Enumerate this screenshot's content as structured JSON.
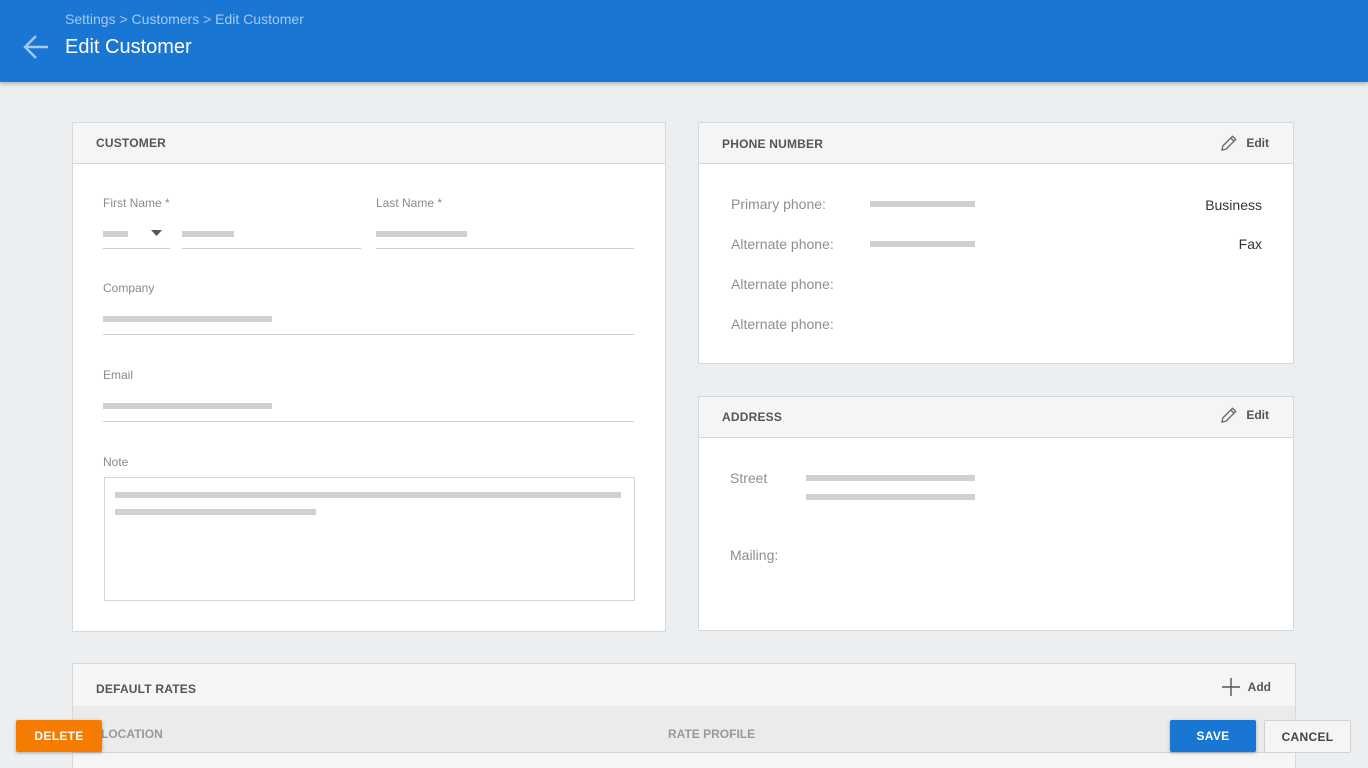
{
  "header": {
    "breadcrumb": "Settings > Customers > Edit Customer",
    "title": "Edit Customer",
    "back_icon": "arrow-left-icon",
    "color": "#1976d2"
  },
  "customer_card": {
    "title": "CUSTOMER",
    "first_name_label": "First Name *",
    "last_name_label": "Last Name *",
    "company_label": "Company",
    "email_label": "Email",
    "note_label": "Note"
  },
  "phone_card": {
    "title": "PHONE NUMBER",
    "edit_label": "Edit",
    "edit_icon": "pencil-icon",
    "rows": [
      {
        "label": "Primary phone:",
        "type": "Business"
      },
      {
        "label": "Alternate phone:",
        "type": "Fax"
      },
      {
        "label": "Alternate phone:",
        "type": ""
      },
      {
        "label": "Alternate phone:",
        "type": ""
      }
    ]
  },
  "address_card": {
    "title": "ADDRESS",
    "edit_label": "Edit",
    "edit_icon": "pencil-icon",
    "street_label": "Street",
    "mailing_label": "Mailing:"
  },
  "rates_card": {
    "title": "DEFAULT RATES",
    "add_label": "Add",
    "add_icon": "plus-icon",
    "columns": [
      "LOCATION",
      "RATE PROFILE"
    ]
  },
  "footer": {
    "delete_label": "DELETE",
    "save_label": "SAVE",
    "cancel_label": "CANCEL",
    "delete_color": "#f57c00",
    "save_color": "#1976d2"
  }
}
